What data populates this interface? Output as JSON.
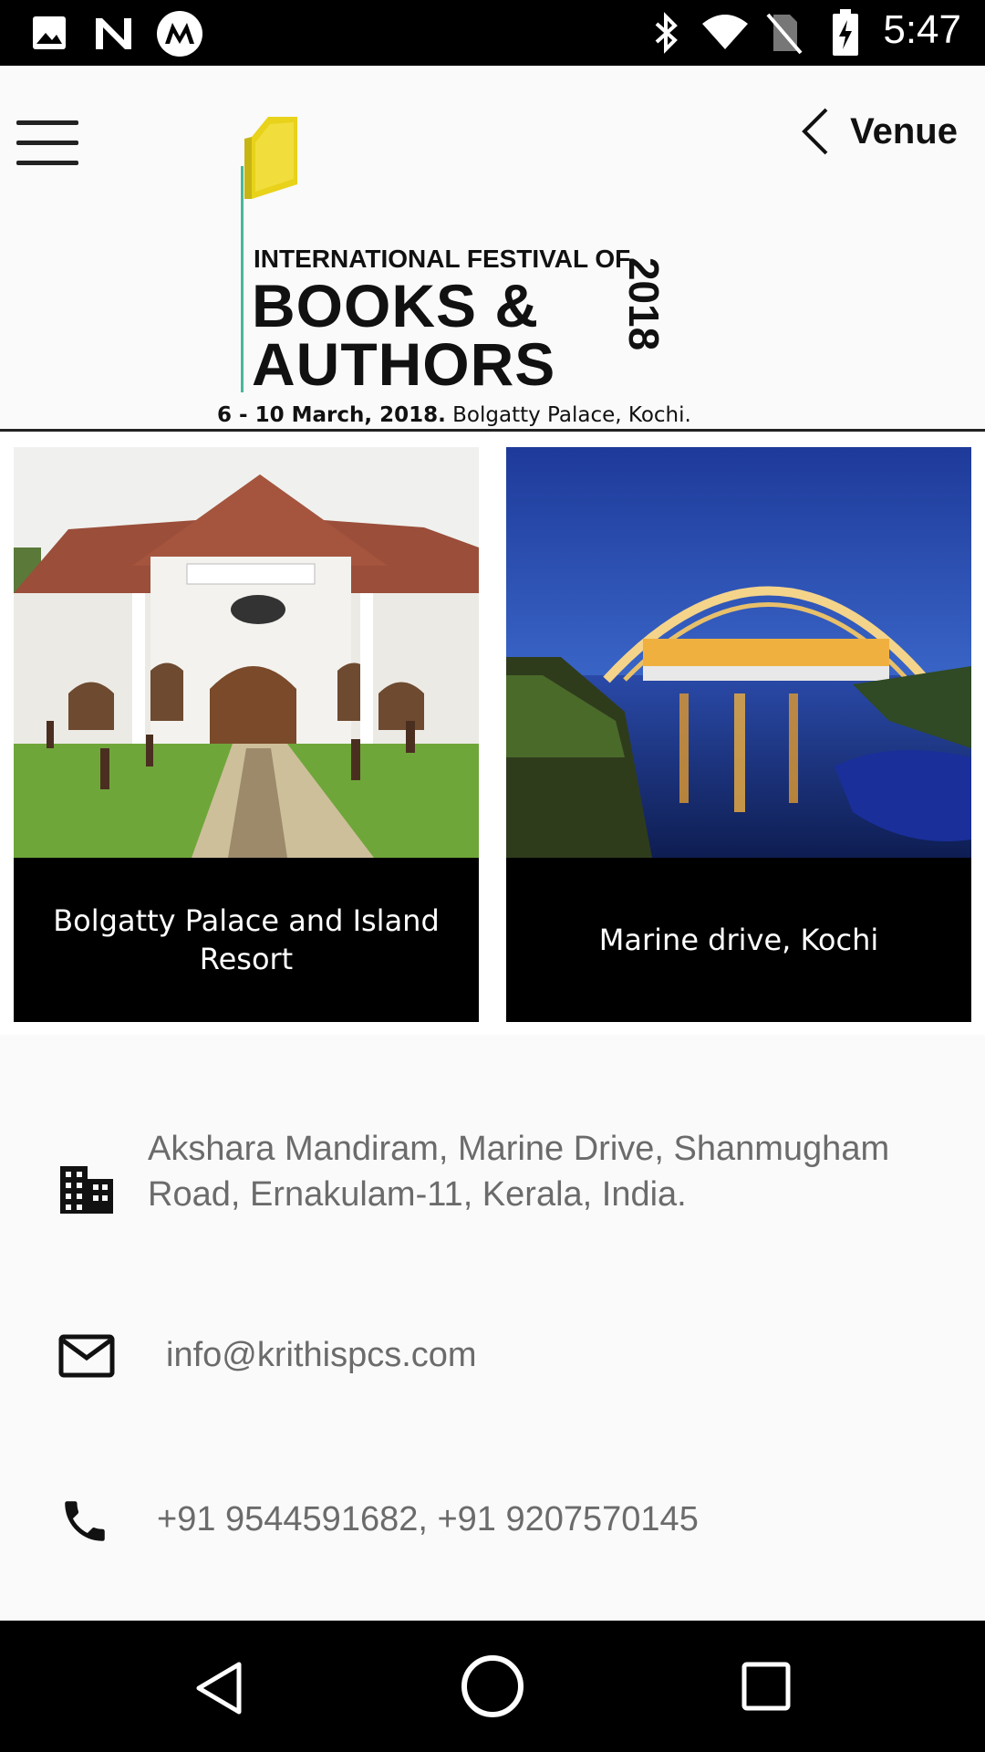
{
  "status_bar": {
    "time": "5:47",
    "left_icons": [
      "image-icon",
      "n-notification-icon",
      "motorola-icon"
    ],
    "right_icons": [
      "bluetooth-icon",
      "wifi-icon",
      "no-sim-icon",
      "battery-charging-icon"
    ]
  },
  "header": {
    "menu_icon": "hamburger-menu-icon",
    "back_icon": "chevron-left-icon",
    "title": "Venue",
    "logo": {
      "line1": "INTERNATIONAL FESTIVAL OF",
      "line2": "BOOKS &",
      "line3": "AUTHORS",
      "year": "2018",
      "dates": "6 - 10 March, 2018.",
      "place": " Bolgatty Palace, Kochi."
    }
  },
  "venues": [
    {
      "name": "Bolgatty Palace and Island Resort",
      "image": "palace-photo"
    },
    {
      "name": "Marine drive, Kochi",
      "image": "marine-drive-night-photo"
    }
  ],
  "contact": {
    "address": " Akshara Mandiram, Marine Drive, Shanmugham Road, Ernakulam-11, Kerala, India.",
    "email": "info@krithispcs.com",
    "phone": "+91 9544591682, +91 9207570145",
    "icons": {
      "address": "building-icon",
      "email": "mail-icon",
      "phone": "phone-icon"
    }
  },
  "nav_bar": {
    "buttons": [
      "back-triangle-icon",
      "home-circle-icon",
      "recents-square-icon"
    ]
  },
  "colors": {
    "logo_book": "#e8d21a",
    "logo_line": "#48b89a",
    "card_bg": "#000000",
    "contact_text": "#6b6b6b"
  }
}
